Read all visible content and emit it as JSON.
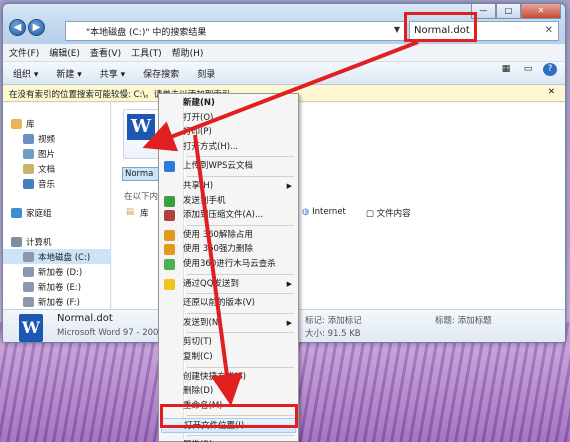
{
  "window": {
    "address": "\"本地磁盘 (C:)\" 中的搜索结果",
    "search_value": "Normal.dot",
    "controls": [
      "—",
      "□",
      "✕"
    ]
  },
  "menubar": [
    "文件(F)",
    "编辑(E)",
    "查看(V)",
    "工具(T)",
    "帮助(H)"
  ],
  "toolbar": {
    "organize": "组织 ▾",
    "new": "新建 ▾",
    "share": "共享 ▾",
    "save_search": "保存搜索",
    "burn": "刻录"
  },
  "infobar": {
    "text": "在没有索引的位置搜索可能较慢: C:\\。请单击以添加到索引...",
    "close": "✕"
  },
  "nav": [
    {
      "label": "库",
      "color": "#e3b75a"
    },
    {
      "label": "视频",
      "color": "#6a8fc2"
    },
    {
      "label": "图片",
      "color": "#6aa0c9"
    },
    {
      "label": "文档",
      "color": "#c9b26a"
    },
    {
      "label": "音乐",
      "color": "#4a7fbf"
    },
    {
      "label": "家庭组",
      "color": "#3d8fd1"
    },
    {
      "label": "计算机",
      "color": "#7f8da0"
    },
    {
      "label": "本地磁盘 (C:)",
      "color": "#8a99ad"
    },
    {
      "label": "新加卷 (D:)",
      "color": "#8a99ad"
    },
    {
      "label": "新加卷 (E:)",
      "color": "#8a99ad"
    },
    {
      "label": "新加卷 (F:)",
      "color": "#8a99ad"
    }
  ],
  "content": {
    "file_label": "Norma",
    "search_again": "在以下内",
    "lib": "库",
    "internet": "Internet",
    "file_content": "文件内容"
  },
  "details": {
    "name": "Normal.dot",
    "type": "Microsoft Word 97 - 2003",
    "tags": "标记: 添加标记",
    "size": "大小: 91.5 KB",
    "title": "标题: 添加标题"
  },
  "context_menu": [
    {
      "label": "新建(N)",
      "bold": true
    },
    {
      "label": "打开(O)"
    },
    {
      "label": "打印(P)"
    },
    {
      "label": "打开方式(H)..."
    },
    {
      "sep": true
    },
    {
      "label": "上传到WPS云文档",
      "icon": "#2f7ad9"
    },
    {
      "sep": true
    },
    {
      "label": "共享(H)",
      "sub": true
    },
    {
      "label": "发送到手机",
      "icon": "#3b9f3b"
    },
    {
      "label": "添加到压缩文件(A)...",
      "icon": "#b0403a"
    },
    {
      "sep": true
    },
    {
      "label": "使用 360解除占用",
      "icon": "#e39a1c"
    },
    {
      "label": "使用 360强力删除",
      "icon": "#e39a1c"
    },
    {
      "label": "使用360进行木马云查杀",
      "icon": "#4caf50"
    },
    {
      "sep": true
    },
    {
      "label": "通过QQ发送到",
      "icon": "#f0c419",
      "sub": true
    },
    {
      "sep": true
    },
    {
      "label": "还原以前的版本(V)"
    },
    {
      "sep": true
    },
    {
      "label": "发送到(N)",
      "sub": true
    },
    {
      "sep": true
    },
    {
      "label": "剪切(T)"
    },
    {
      "label": "复制(C)"
    },
    {
      "sep": true
    },
    {
      "label": "创建快捷方式(S)"
    },
    {
      "label": "删除(D)"
    },
    {
      "label": "重命名(M)"
    },
    {
      "sep": true
    },
    {
      "label": "打开文件位置(I)",
      "highlight": true
    },
    {
      "sep": true
    },
    {
      "label": "属性(R)"
    }
  ],
  "annotation_color": "#e02020"
}
